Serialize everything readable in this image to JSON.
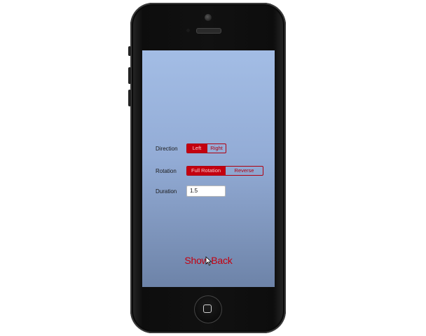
{
  "form": {
    "direction": {
      "label": "Direction",
      "options": [
        "Left",
        "Right"
      ],
      "selected": "Left"
    },
    "rotation": {
      "label": "Rotation",
      "options": [
        "Full Rotation",
        "Reverse"
      ],
      "selected": "Full Rotation"
    },
    "duration": {
      "label": "Duration",
      "value": "1.5"
    }
  },
  "action": {
    "show_back_label": "Show Back"
  },
  "colors": {
    "accent": "#c4000f",
    "screen_top": "#a3bde5",
    "screen_bottom": "#6d83a8",
    "phone_body": "#111111"
  },
  "icons": {
    "home": "home-button-icon",
    "camera": "front-camera-icon",
    "speaker": "earpiece-speaker-icon",
    "cursor": "mouse-pointer-icon"
  }
}
